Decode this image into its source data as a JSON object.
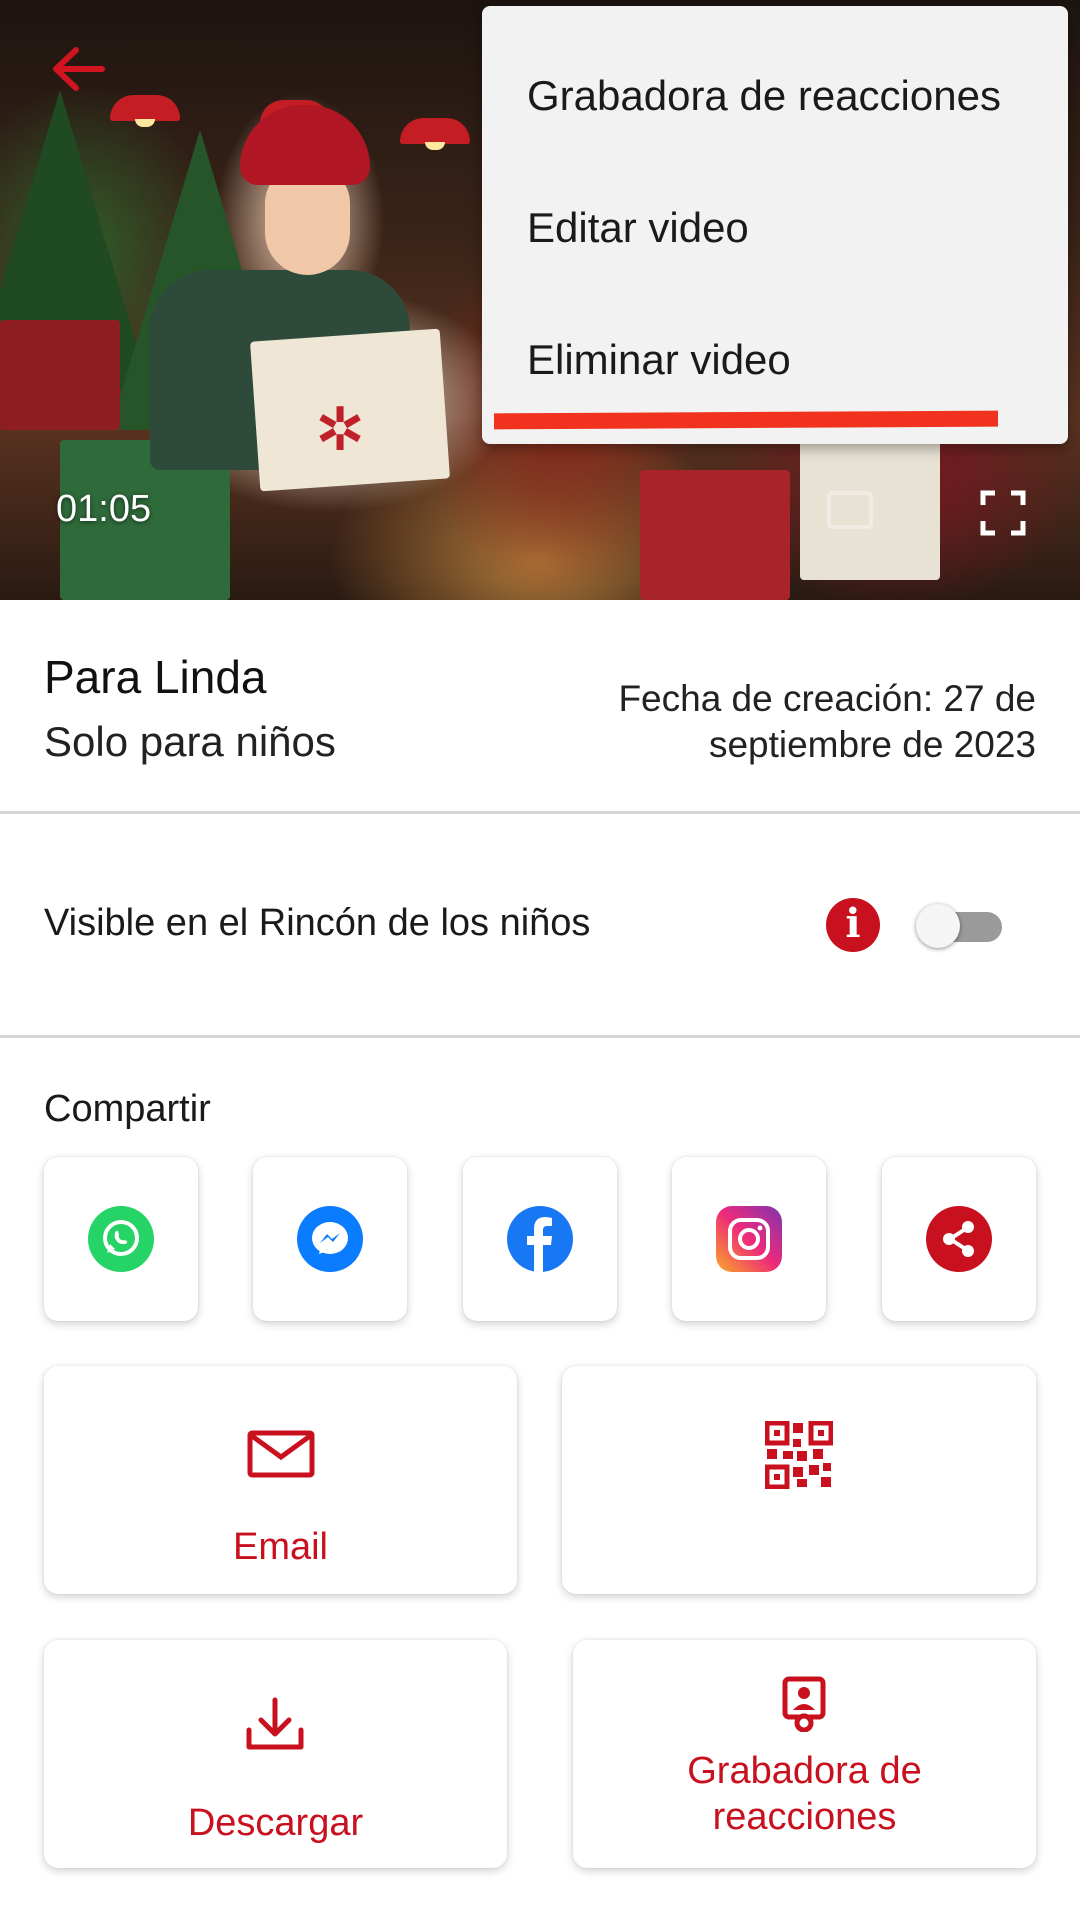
{
  "video": {
    "duration": "01:05"
  },
  "menu": {
    "items": [
      {
        "label": "Grabadora de reacciones"
      },
      {
        "label": "Editar video"
      },
      {
        "label": "Eliminar video"
      }
    ]
  },
  "info": {
    "title": "Para Linda",
    "subtitle": "Solo para  niños",
    "created": "Fecha de creación: 27 de septiembre de 2023"
  },
  "visibility": {
    "label": "Visible en el Rincón de los niños",
    "info_glyph": "i",
    "enabled": false
  },
  "share": {
    "label": "Compartir",
    "apps": [
      {
        "icon": "whatsapp-icon",
        "color": "#25d366"
      },
      {
        "icon": "messenger-icon",
        "color": "#0a7cff"
      },
      {
        "icon": "facebook-icon",
        "color": "#1877f2"
      },
      {
        "icon": "instagram-icon",
        "color": "#e1306c"
      },
      {
        "icon": "share-icon",
        "color": "#c8101e"
      }
    ]
  },
  "actions": {
    "email_label": "Email",
    "qr_icon": "qr-code-icon",
    "download_label": "Descargar",
    "reaction_recorder_label": "Grabadora de reacciones"
  },
  "colors": {
    "accent": "#c8101e",
    "highlight": "#f0321e"
  }
}
